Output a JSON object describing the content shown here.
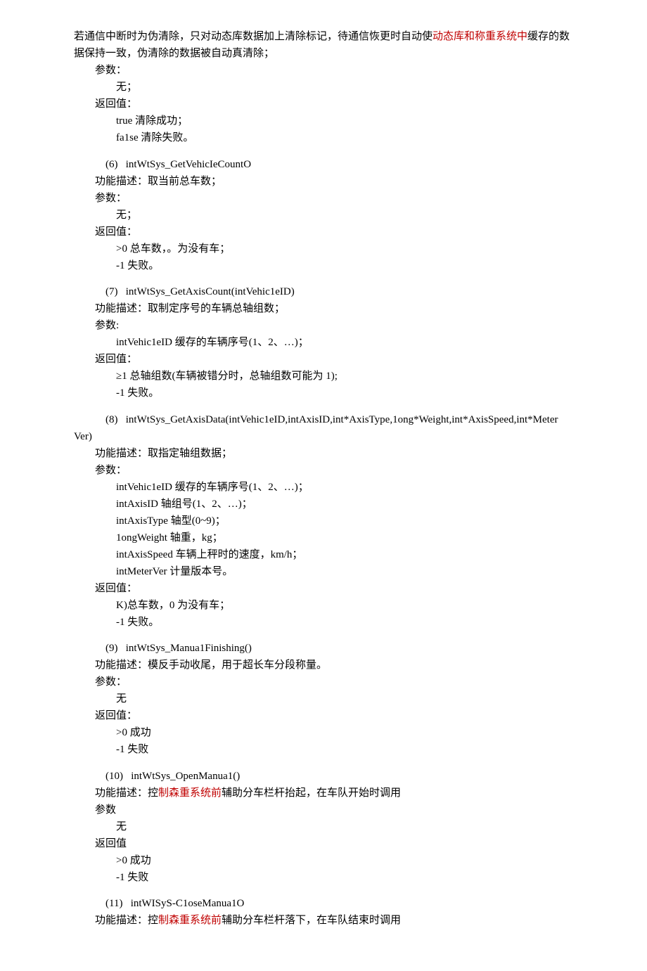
{
  "intro": {
    "l1a": "若通信中断时为伪清除，只对动态库数据加上清除标记，待通信恢更时自动使",
    "l1red": "动态库和称重系统中",
    "l1b": "缓存的数",
    "l2": "据保持一致，伪清除的数据被自动真清除；",
    "params": "参数：",
    "none": "无；",
    "ret": "返回值：",
    "r1": "true 清除成功；",
    "r2": "fa1se 清除失败。"
  },
  "f6": {
    "sig": "intWtSys_GetVehicIeCountO",
    "desc": "功能描述：取当前总车数；",
    "params": "参数：",
    "none": "无；",
    "ret": "返回值：",
    "r1": ">0 总车数，。为没有车；",
    "r2": "-1 失败。"
  },
  "f7": {
    "sig": "intWtSys_GetAxisCount(intVehic1eID)",
    "desc": "功能描述：取制定序号的车辆总轴组数；",
    "params": "参数:",
    "p1": "intVehic1eID 缓存的车辆序号(1、2、…)；",
    "ret": "返回值：",
    "r1": "≥1 总轴组数(车辆被错分时，总轴组数可能为 1);",
    "r2": "-1 失败。"
  },
  "f8": {
    "sig_a": "intWtSys_GetAxisData(intVehic1eID,intAxisID,int*AxisType,1ong*Weight,int*AxisSpeed,int*Meter",
    "sig_b": "Ver)",
    "desc": "功能描述：取指定轴组数据；",
    "params": "参数：",
    "p1": "intVehic1eID 缓存的车辆序号(1、2、…)；",
    "p2": "intAxisID    轴组号(1、2、…)；",
    "p3": "intAxisType 轴型(0~9)；",
    "p4": "1ongWeight 轴重，kg；",
    "p5": "intAxisSpeed 车辆上秤时的速度，km/h；",
    "p6": "intMeterVer 计量版本号。",
    "ret": "返回值：",
    "r1": "K)总车数，0 为没有车；",
    "r2": "-1 失败。"
  },
  "f9": {
    "sig": "intWtSys_Manua1Finishing()",
    "desc": "功能描述：模反手动收尾，用于超长车分段称量。",
    "params": "参数：",
    "none": "无",
    "ret": "返回值：",
    "r1": ">0 成功",
    "r2": "-1 失败"
  },
  "f10": {
    "sig": "intWtSys_OpenManua1()",
    "desc_a": "功能描述：控",
    "desc_red": "制森重系统前",
    "desc_b": "辅助分车栏杆抬起，在车队开始时调用",
    "params": "参数",
    "none": "无",
    "ret": "返回值",
    "r1": ">0 成功",
    "r2": "-1 失败"
  },
  "f11": {
    "sig": "intWISyS-C1oseManua1O",
    "desc_a": "功能描述：控",
    "desc_red": "制森重系统前",
    "desc_b": "辅助分车栏杆落下，在车队结束时调用"
  }
}
